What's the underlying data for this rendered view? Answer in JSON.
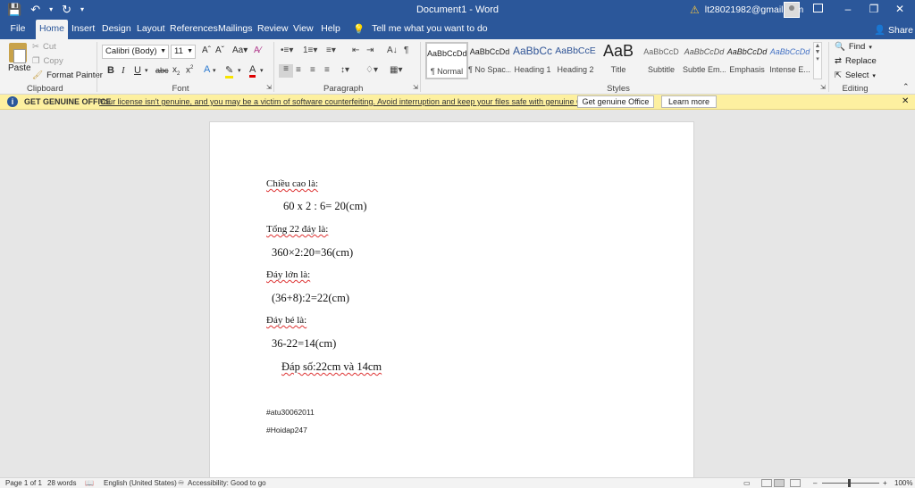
{
  "window": {
    "title": "Document1  -  Word",
    "account_email": "lt28021982@gmail.com"
  },
  "quick_access": {
    "save_icon": "save-icon",
    "undo_icon": "undo-icon",
    "redo_icon": "redo-icon",
    "customize_icon": "customize-qat-icon"
  },
  "tabs": [
    {
      "label": "File"
    },
    {
      "label": "Home"
    },
    {
      "label": "Insert"
    },
    {
      "label": "Design"
    },
    {
      "label": "Layout"
    },
    {
      "label": "References"
    },
    {
      "label": "Mailings"
    },
    {
      "label": "Review"
    },
    {
      "label": "View"
    },
    {
      "label": "Help"
    }
  ],
  "tellme": {
    "text": "Tell me what you want to do"
  },
  "share_label": "Share",
  "clipboard": {
    "paste": "Paste",
    "cut": "Cut",
    "copy": "Copy",
    "format_painter": "Format Painter",
    "group": "Clipboard"
  },
  "font": {
    "family": "Calibri (Body)",
    "size": "11",
    "case_label": "Aa",
    "group": "Font"
  },
  "paragraph": {
    "group": "Paragraph"
  },
  "styles": {
    "group": "Styles",
    "items": [
      {
        "sample": "AaBbCcDd",
        "name": "¶ Normal"
      },
      {
        "sample": "AaBbCcDd",
        "name": "¶ No Spac..."
      },
      {
        "sample": "AaBbCc",
        "name": "Heading 1"
      },
      {
        "sample": "AaBbCcE",
        "name": "Heading 2"
      },
      {
        "sample": "AaB",
        "name": "Title"
      },
      {
        "sample": "AaBbCcD",
        "name": "Subtitle"
      },
      {
        "sample": "AaBbCcDd",
        "name": "Subtle Em..."
      },
      {
        "sample": "AaBbCcDd",
        "name": "Emphasis"
      },
      {
        "sample": "AaBbCcDd",
        "name": "Intense E..."
      }
    ]
  },
  "editing": {
    "find": "Find",
    "replace": "Replace",
    "select": "Select",
    "group": "Editing"
  },
  "infobar": {
    "title": "GET GENUINE OFFICE",
    "message": "Your license isn't genuine, and you may be a victim of software counterfeiting. Avoid interruption and keep your files safe with genuine Office today.",
    "button_genuine": "Get genuine Office",
    "button_learn": "Learn more"
  },
  "document": {
    "l1": "Chiều cao là:",
    "l2": "60 x 2 : 6= 20(cm)",
    "l3": "Tổng 22 đáy là:",
    "l4": "360×2:20=36(cm)",
    "l5": "Đáy lớn là:",
    "l6": "(36+8):2=22(cm)",
    "l7": "Đáy bé là:",
    "l8": "36-22=14(cm)",
    "l9": "Đáp số:22cm và 14cm",
    "tag1": "#atu30062011",
    "tag2": "#Hoidap247"
  },
  "status": {
    "page": "Page 1 of 1",
    "words": "28 words",
    "language": "English (United States)",
    "accessibility": "Accessibility: Good to go",
    "zoom": "100%",
    "zoom_percent": 100
  }
}
